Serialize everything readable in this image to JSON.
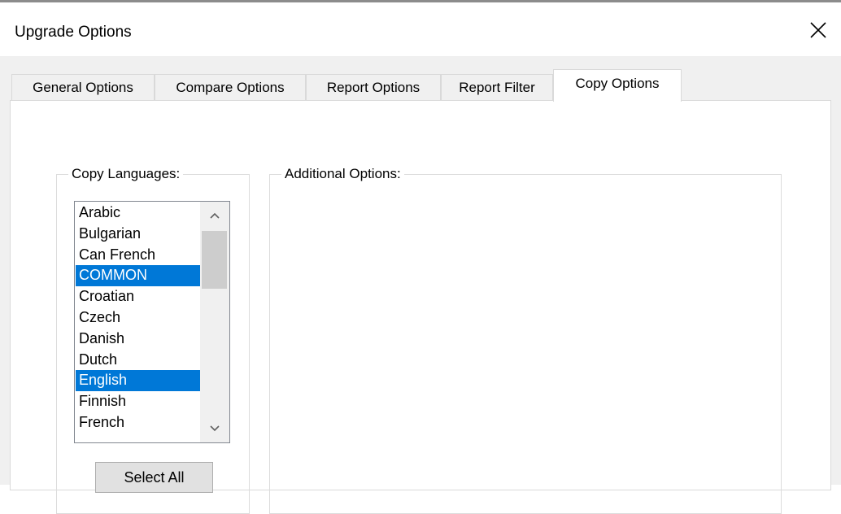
{
  "window": {
    "title": "Upgrade Options"
  },
  "tabs": [
    {
      "label": "General Options",
      "active": false
    },
    {
      "label": "Compare Options",
      "active": false
    },
    {
      "label": "Report Options",
      "active": false
    },
    {
      "label": "Report Filter",
      "active": false
    },
    {
      "label": "Copy Options",
      "active": true
    }
  ],
  "copy_languages": {
    "legend": "Copy Languages:",
    "items": [
      {
        "label": "Arabic",
        "selected": false
      },
      {
        "label": "Bulgarian",
        "selected": false
      },
      {
        "label": "Can French",
        "selected": false
      },
      {
        "label": "COMMON",
        "selected": true
      },
      {
        "label": "Croatian",
        "selected": false
      },
      {
        "label": "Czech",
        "selected": false
      },
      {
        "label": "Danish",
        "selected": false
      },
      {
        "label": "Dutch",
        "selected": false
      },
      {
        "label": "English",
        "selected": true
      },
      {
        "label": "Finnish",
        "selected": false
      },
      {
        "label": "French",
        "selected": false
      }
    ],
    "select_all_label": "Select All"
  },
  "additional_options": {
    "legend": "Additional Options:"
  },
  "colors": {
    "selection": "#0078d7",
    "tab_panel": "#ffffff",
    "dialog_background": "#f0f0f0"
  },
  "icons": {
    "close": "close-icon",
    "scroll_up": "chevron-up-icon",
    "scroll_down": "chevron-down-icon"
  }
}
